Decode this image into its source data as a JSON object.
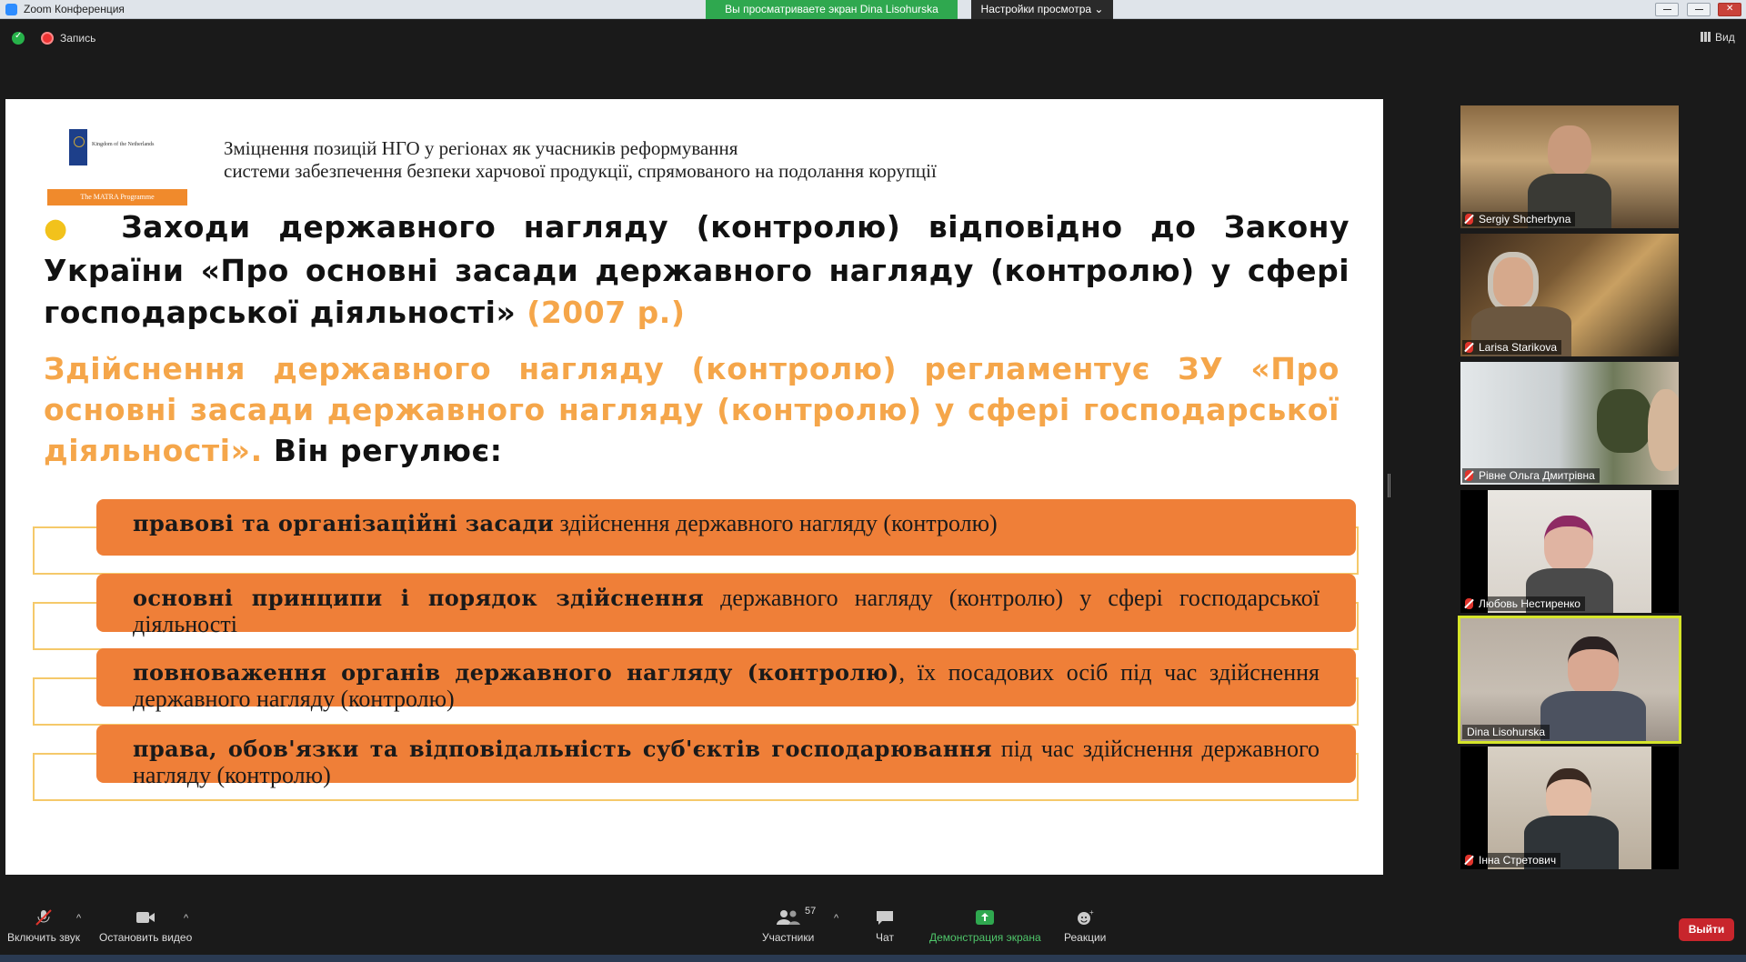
{
  "window": {
    "title": "Zoom Конференция",
    "share_banner": "Вы просматриваете экран Dina Lisohurska",
    "view_settings": "Настройки просмотра ⌄"
  },
  "status": {
    "record_label": "Запись",
    "view_label": "Вид"
  },
  "slide": {
    "logo_text": "Kingdom of the Netherlands",
    "programme_badge": "The MATRA Programme",
    "header_line1": "Зміцнення позицій НГО у регіонах як учасників реформування",
    "header_line2": "системи забезпечення безпеки харчової продукції, спрямованого на подолання корупції",
    "heading_main": "Заходи державного нагляду (контролю) відповідно до Закону України «Про основні засади державного нагляду (контролю) у сфері господарської діяльності»",
    "heading_year": "(2007 р.)",
    "para_orange": "Здійснення державного нагляду (контролю) регламентує ЗУ «Про основні засади державного нагляду (контролю) у сфері господарської діяльності».",
    "para_dark": "Він регулює:",
    "items": [
      {
        "bold": "правові та організаційні засади",
        "rest": " здійснення державного нагляду (контролю)"
      },
      {
        "bold": "основні принципи і порядок здійснення",
        "rest": " державного нагляду (контролю) у сфері господарської діяльності"
      },
      {
        "bold": "повноваження органів державного нагляду (контролю)",
        "rest": ", їх посадових осіб під час здійснення державного нагляду (контролю)"
      },
      {
        "bold": "права, обов'язки та відповідальність суб'єктів господарювання",
        "rest": " під час здійснення державного нагляду (контролю)"
      }
    ]
  },
  "participants_panel": [
    {
      "name": "Sergiy Shcherbyna"
    },
    {
      "name": "Larisa Starikova"
    },
    {
      "name": "Рівне Ольга Дмитрівна"
    },
    {
      "name": "Любовь Нестиренко"
    },
    {
      "name": "Dina Lisohurska"
    },
    {
      "name": "Інна Стретович"
    }
  ],
  "toolbar": {
    "unmute_label": "Включить звук",
    "stop_video_label": "Остановить видео",
    "participants_label": "Участники",
    "participants_count": "57",
    "chat_label": "Чат",
    "share_label": "Демонстрация экрана",
    "reactions_label": "Реакции",
    "leave_label": "Выйти"
  },
  "colors": {
    "slide_orange": "#ef7f38",
    "accent_orange_text": "#f5a64a",
    "share_green": "#2fa84f",
    "leave_red": "#c8252c",
    "active_speaker": "#d5e52a"
  }
}
